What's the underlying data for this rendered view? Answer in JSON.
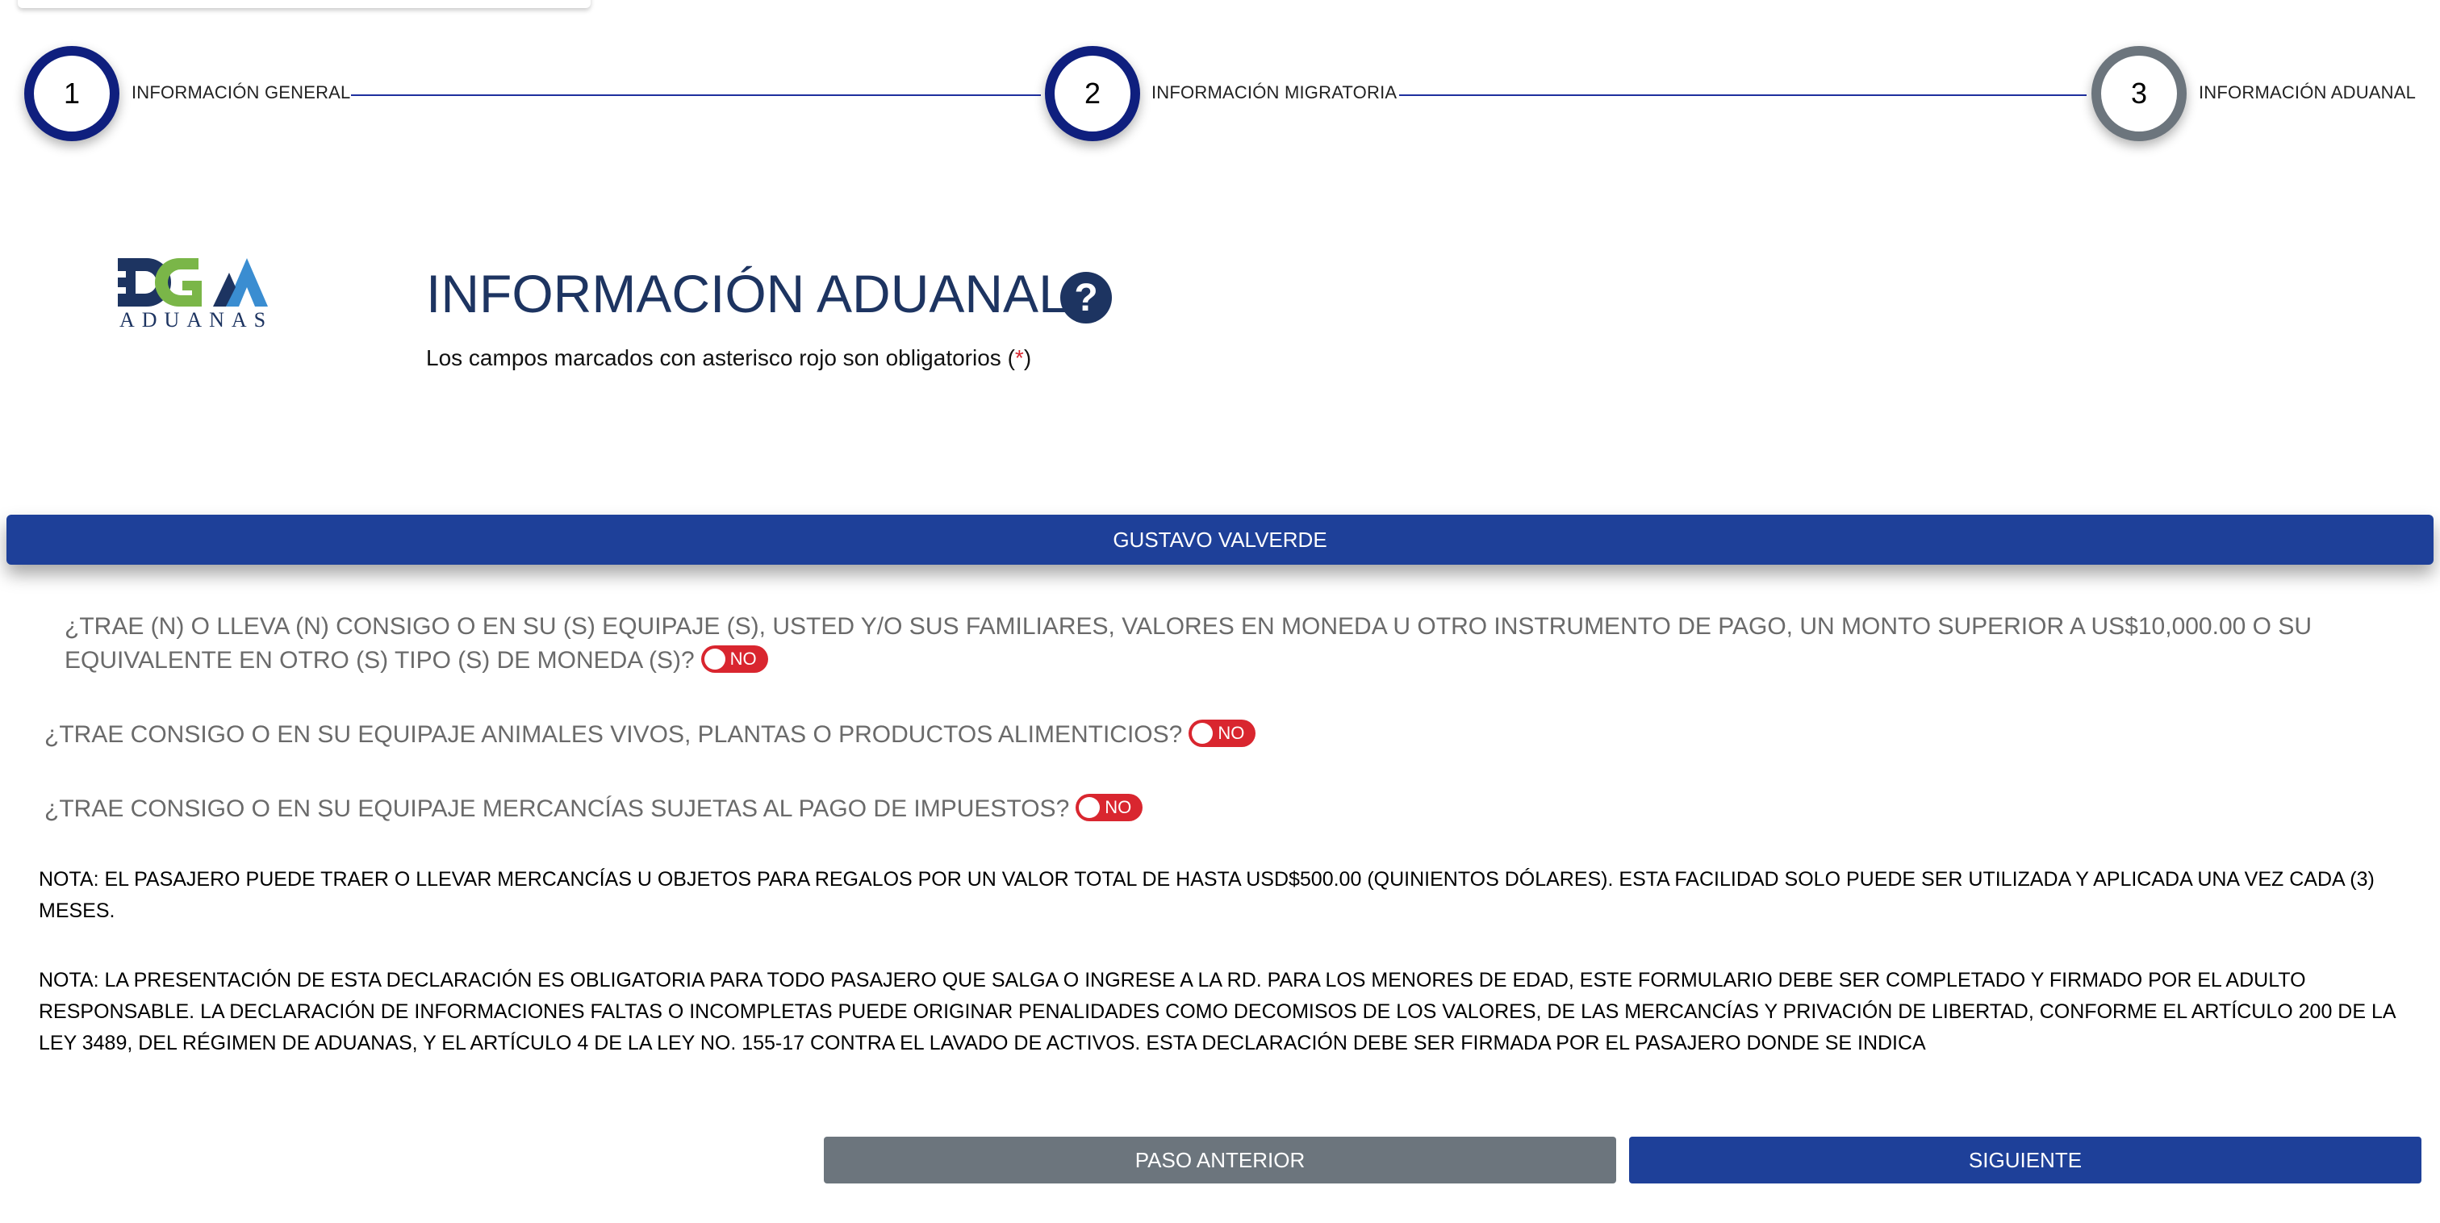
{
  "stepper": {
    "steps": [
      {
        "number": "1",
        "label": "INFORMACIÓN GENERAL"
      },
      {
        "number": "2",
        "label": "INFORMACIÓN MIGRATORIA"
      },
      {
        "number": "3",
        "label": "INFORMACIÓN ADUANAL"
      }
    ]
  },
  "header": {
    "logo_text": "ADUANAS",
    "title": "INFORMACIÓN ADUANAL",
    "help_icon": "question-circle-icon",
    "subtitle_pre": "Los campos marcados con asterisco rojo son obligatorios (",
    "subtitle_star": "*",
    "subtitle_post": ")"
  },
  "passenger": {
    "name": "GUSTAVO VALVERDE"
  },
  "questions": [
    {
      "text": "¿TRAE (N) O LLEVA (N) CONSIGO O EN SU (S) EQUIPAJE (S), USTED Y/O SUS FAMILIARES, VALORES EN MONEDA U OTRO INSTRUMENTO DE PAGO, UN MONTO SUPERIOR A US$10,000.00 O SU EQUIVALENTE EN OTRO (S) TIPO (S) DE MONEDA (S)?",
      "answer": "NO"
    },
    {
      "text": "¿TRAE CONSIGO O EN SU EQUIPAJE ANIMALES VIVOS, PLANTAS O PRODUCTOS ALIMENTICIOS?",
      "answer": "NO"
    },
    {
      "text": "¿TRAE CONSIGO O EN SU EQUIPAJE MERCANCÍAS SUJETAS AL PAGO DE IMPUESTOS?",
      "answer": "NO"
    }
  ],
  "notes": [
    "NOTA: EL PASAJERO PUEDE TRAER O LLEVAR MERCANCÍAS U OBJETOS PARA REGALOS POR UN VALOR TOTAL DE HASTA USD$500.00 (QUINIENTOS DÓLARES). ESTA FACILIDAD SOLO PUEDE SER UTILIZADA Y APLICADA UNA VEZ CADA (3) MESES.",
    "NOTA: LA PRESENTACIÓN DE ESTA DECLARACIÓN ES OBLIGATORIA PARA TODO PASAJERO QUE SALGA O INGRESE A LA RD. PARA LOS MENORES DE EDAD, ESTE FORMULARIO DEBE SER COMPLETADO Y FIRMADO POR EL ADULTO RESPONSABLE. LA DECLARACIÓN DE INFORMACIONES FALTAS O INCOMPLETAS PUEDE ORIGINAR PENALIDADES COMO DECOMISOS DE LOS VALORES, DE LAS MERCANCÍAS Y PRIVACIÓN DE LIBERTAD, CONFORME EL ARTÍCULO 200 DE LA LEY 3489, DEL RÉGIMEN DE ADUANAS, Y EL ARTÍCULO 4 DE LA LEY NO. 155-17 CONTRA EL LAVADO DE ACTIVOS. ESTA DECLARACIÓN DEBE SER FIRMADA POR EL PASAJERO DONDE SE INDICA"
  ],
  "buttons": {
    "prev": "PASO ANTERIOR",
    "next": "SIGUIENTE"
  },
  "colors": {
    "primary": "#1e4099",
    "step_active": "#0f1f7e",
    "step_inactive": "#6c757d",
    "toggle_no": "#d9262f",
    "title": "#1d3461",
    "logo_green": "#7ab648",
    "logo_blue": "#3a8dd1"
  }
}
